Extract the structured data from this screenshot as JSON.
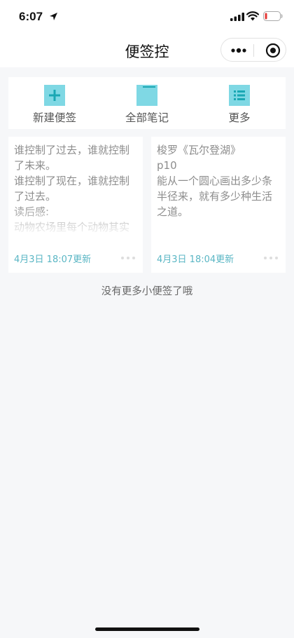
{
  "status": {
    "time": "6:07",
    "battery_level": 0.15,
    "icons": [
      "location-arrow-icon",
      "signal-icon",
      "wifi-icon",
      "battery-icon"
    ]
  },
  "nav": {
    "title": "便签控",
    "capsule_icons": [
      "more-dots-icon",
      "target-icon"
    ]
  },
  "toolbar": {
    "items": [
      {
        "label": "新建便签",
        "icon": "plus-square-icon"
      },
      {
        "label": "全部笔记",
        "icon": "folder-icon"
      },
      {
        "label": "更多",
        "icon": "list-icon"
      }
    ]
  },
  "notes": [
    {
      "body": "谁控制了过去，谁就控制了未来。\n谁控制了现在，谁就控制了过去。\n读后感:\n动物农场里每个动物其实",
      "date": "4月3日  18:07更新"
    },
    {
      "body": "梭罗《瓦尔登湖》\np10\n能从一个圆心画出多少条半径来，就有多少种生活之道。",
      "date": "4月3日  18:04更新"
    }
  ],
  "footer": {
    "end_text": "没有更多小便签了哦"
  },
  "colors": {
    "accent": "#5ab6c4",
    "icon_teal": "#7fd8e4",
    "icon_dark": "#1aa7b3",
    "background": "#f6f7f9",
    "battery_red": "#e53935"
  }
}
